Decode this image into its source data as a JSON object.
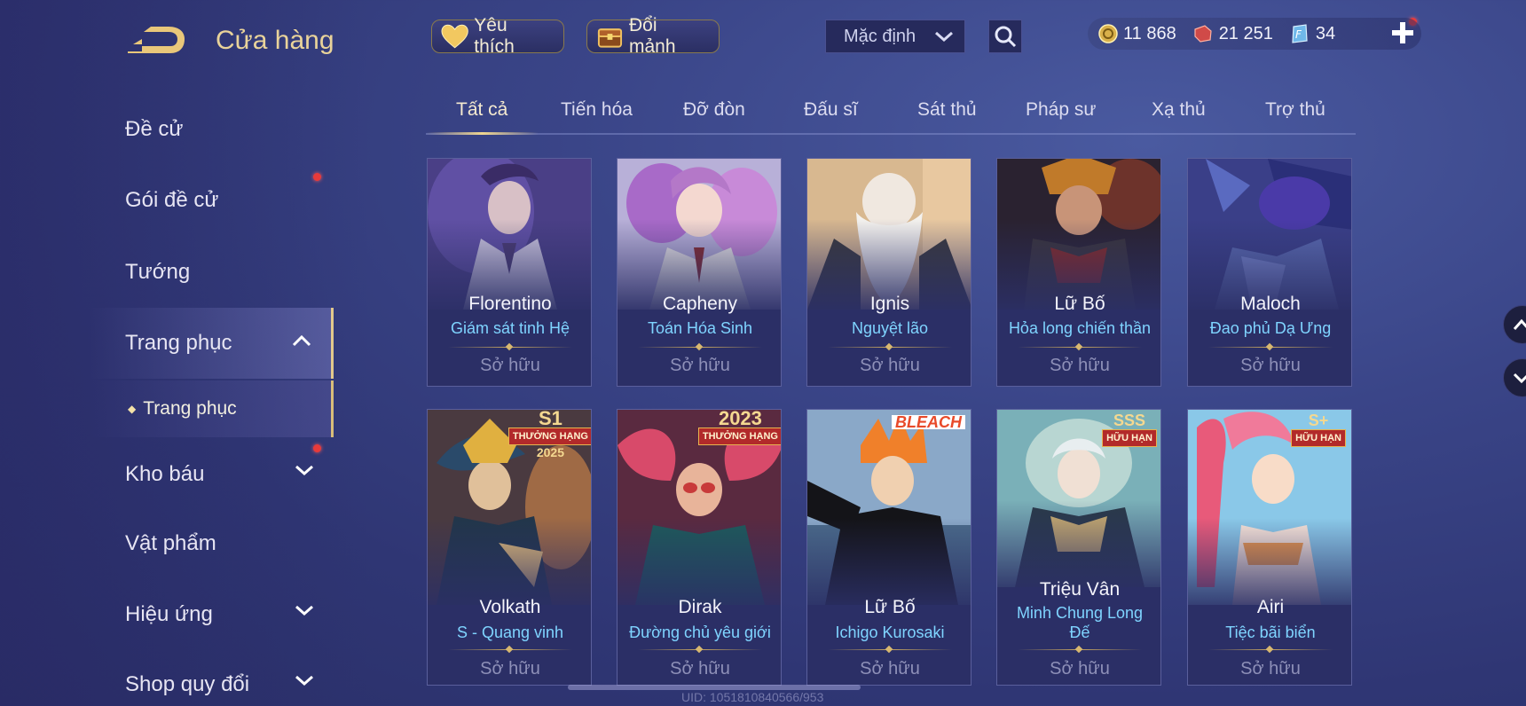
{
  "header": {
    "title": "Cửa hàng",
    "favorites_label": "Yêu thích",
    "swap_label": "Đổi mảnh",
    "sort_value": "Mặc định"
  },
  "currency": {
    "gold": "11 868",
    "coupons": "21 251",
    "gems": "34"
  },
  "sidebar": {
    "items": [
      {
        "label": "Đề cử"
      },
      {
        "label": "Gói đề cử"
      },
      {
        "label": "Tướng"
      },
      {
        "label": "Trang phục"
      },
      {
        "label": "Trang phục"
      },
      {
        "label": "Kho báu"
      },
      {
        "label": "Vật phẩm"
      },
      {
        "label": "Hiệu ứng"
      },
      {
        "label": "Shop quy đổi"
      }
    ]
  },
  "tabs": [
    "Tất cả",
    "Tiến hóa",
    "Đỡ đòn",
    "Đấu sĩ",
    "Sát thủ",
    "Pháp sư",
    "Xạ thủ",
    "Trợ thủ"
  ],
  "cards": [
    {
      "hero": "Florentino",
      "skin": "Giám sát tinh Hệ",
      "status": "Sở hữu"
    },
    {
      "hero": "Capheny",
      "skin": "Toán Hóa Sinh",
      "status": "Sở hữu"
    },
    {
      "hero": "Ignis",
      "skin": "Nguyệt lão",
      "status": "Sở hữu"
    },
    {
      "hero": "Lữ Bố",
      "skin": "Hỏa long chiến thần",
      "status": "Sở hữu"
    },
    {
      "hero": "Maloch",
      "skin": "Đao phủ Dạ Ưng",
      "status": "Sở hữu"
    },
    {
      "hero": "Volkath",
      "skin": "S - Quang vinh",
      "status": "Sở hữu",
      "badge": "S1",
      "badge_sub": "THƯỞNG HẠNG",
      "badge_year": "2025"
    },
    {
      "hero": "Dirak",
      "skin": "Đường chủ yêu giới",
      "status": "Sở hữu",
      "badge": "2023",
      "badge_sub": "THƯỞNG HẠNG"
    },
    {
      "hero": "Lữ Bố",
      "skin": "Ichigo Kurosaki",
      "status": "Sở hữu",
      "badge": "BLEACH"
    },
    {
      "hero": "Triệu Vân",
      "skin": "Minh Chung Long Đế",
      "status": "Sở hữu",
      "badge": "SSS",
      "badge_sub": "HỮU HẠN"
    },
    {
      "hero": "Airi",
      "skin": "Tiệc bãi biển",
      "status": "Sở hữu",
      "badge": "S+",
      "badge_sub": "HỮU HẠN"
    }
  ],
  "uid_text": "UID: 1051810840566/953",
  "colors": {
    "accent_gold": "#e9d39a",
    "skin_name": "#7fd4ff",
    "owned_text": "#8e90b8",
    "notification": "#e83a3a"
  },
  "icons": [
    "back-arrow-icon",
    "heart-icon",
    "chest-icon",
    "chevron-down-icon",
    "search-icon",
    "gold-coin-icon",
    "coupon-icon",
    "gem-icon",
    "plus-icon",
    "chevron-up-icon"
  ]
}
